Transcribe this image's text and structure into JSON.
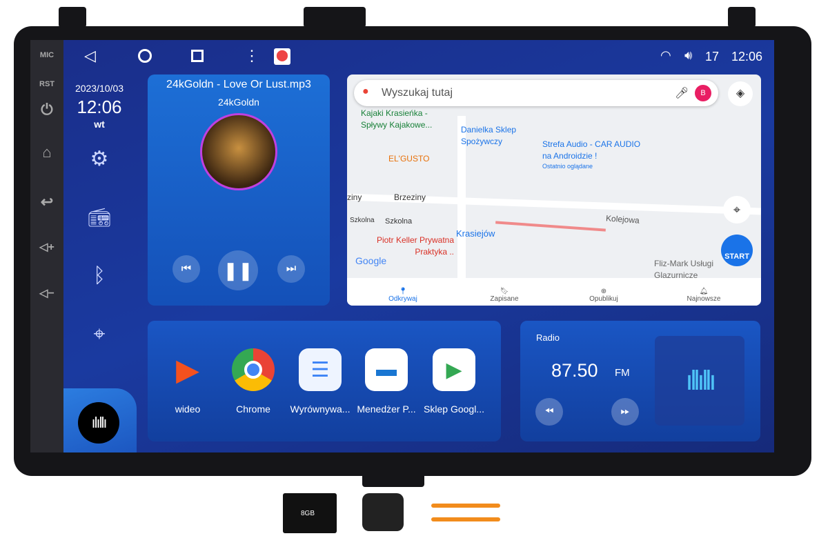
{
  "hardware": {
    "mic": "MIC",
    "rst": "RST"
  },
  "status": {
    "volume": "17",
    "time": "12:06"
  },
  "clock": {
    "date": "2023/10/03",
    "time": "12:06",
    "day": "wt"
  },
  "music": {
    "title": "24kGoldn - Love Or Lust.mp3",
    "artist": "24kGoldn"
  },
  "map": {
    "search_placeholder": "Wyszukaj tutaj",
    "avatar": "B",
    "start": "START",
    "logo": "Google",
    "pois": [
      "Kajaki Krasieńka - Spływy Kajakowe...",
      "Danielka Sklep Spożywczy",
      "Strefa Audio - CAR AUDIO na Androidzie !",
      "Ostatnio oglądane",
      "EL'GUSTO",
      "Brzeziny",
      "Szkolna",
      "Piotr Keller Prywatna Praktyka ..",
      "Krasiejów",
      "Kolejowa",
      "Fliz-Mark Usługi Glazurnicze",
      "ziny",
      "Szkolna"
    ],
    "tabs": [
      "Odkrywaj",
      "Zapisane",
      "Opublikuj",
      "Najnowsze"
    ]
  },
  "apps": [
    {
      "label": "wideo"
    },
    {
      "label": "Chrome"
    },
    {
      "label": "Wyrównywa..."
    },
    {
      "label": "Menedżer P..."
    },
    {
      "label": "Sklep Googl..."
    }
  ],
  "radio": {
    "title": "Radio",
    "frequency": "87.50",
    "band": "FM"
  },
  "accessories": {
    "sd_card": "8GB"
  },
  "colors": {
    "accent": "#1a73e8",
    "screen_bg": "#1a3aa0"
  }
}
